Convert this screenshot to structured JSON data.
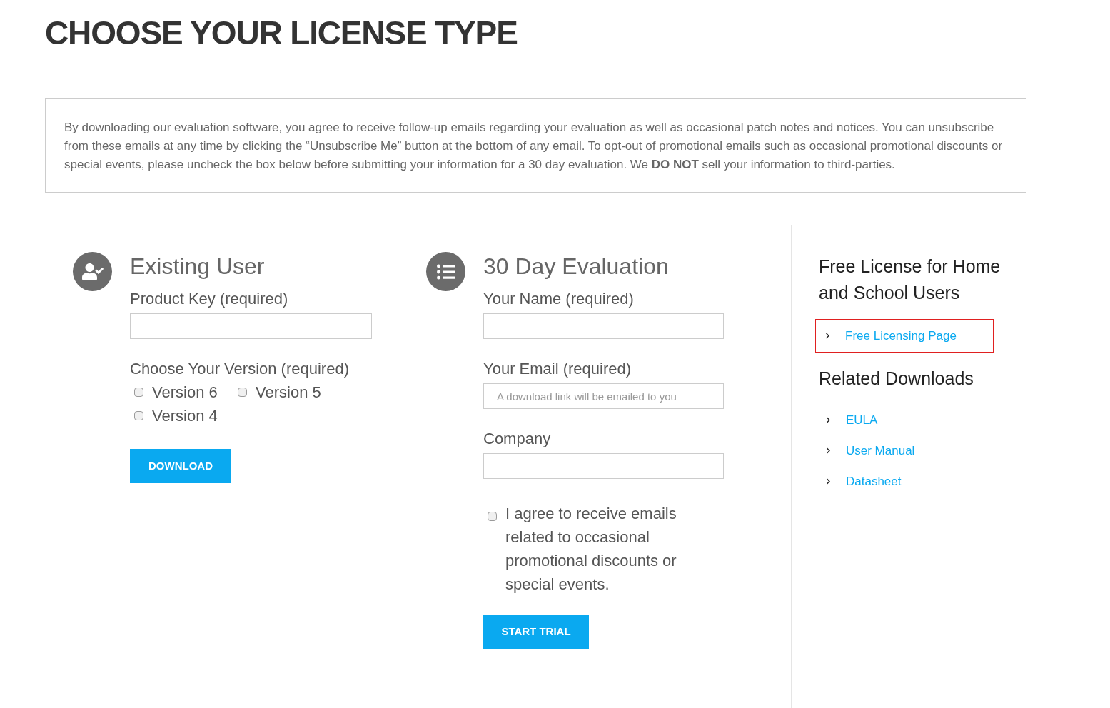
{
  "page_title": "CHOOSE YOUR LICENSE TYPE",
  "notice": "By downloading our evaluation software, you agree to receive follow-up emails regarding your evaluation as well as occasional patch notes and notices. You can unsubscribe from these emails at any time by clicking the “Unsubscribe Me” button at the bottom of any email. To opt-out of promotional emails such as occasional promotional discounts or special events, please uncheck the box below before submitting your information for a 30 day evaluation. We **DO NOT** sell your information to third-parties.",
  "existing_user": {
    "heading": "Existing User",
    "product_key_label": "Product Key (required)",
    "version_label": "Choose Your Version (required)",
    "versions": [
      {
        "label": "Version 6",
        "checked": false
      },
      {
        "label": "Version 5",
        "checked": false
      },
      {
        "label": "Version 4",
        "checked": false
      }
    ],
    "button": "DOWNLOAD"
  },
  "evaluation": {
    "heading": "30 Day Evaluation",
    "fields": [
      {
        "label": "Your Name (required)"
      },
      {
        "label": "Your Email (required)",
        "placeholder": "A download link will be emailed to you"
      },
      {
        "label": "Company"
      }
    ],
    "consent": {
      "label": "I agree to receive emails related to occasional promotional discounts or special events.",
      "checked": false
    },
    "button": "START TRIAL"
  },
  "sidebar": {
    "free_heading": "Free License for Home and School Users",
    "free_links": [
      {
        "label": "Free Licensing Page",
        "highlighted": true
      }
    ],
    "related_heading": "Related Downloads",
    "related_links": [
      {
        "label": "EULA",
        "highlighted": false
      },
      {
        "label": "User Manual",
        "highlighted": false
      },
      {
        "label": "Datasheet",
        "highlighted": false
      }
    ]
  }
}
